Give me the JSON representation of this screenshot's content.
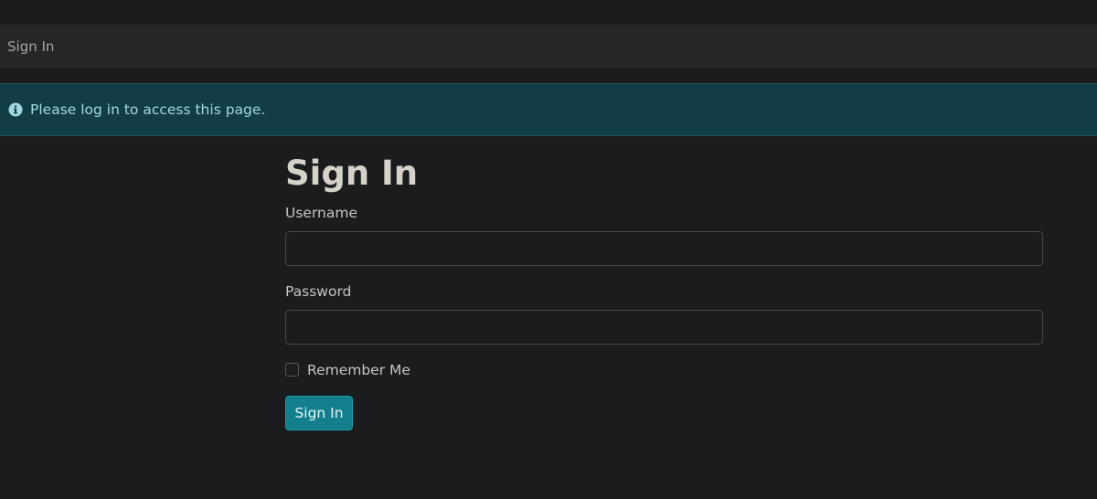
{
  "breadcrumb": {
    "text": "Sign In"
  },
  "alert": {
    "icon": "info-circle-icon",
    "message": "Please log in to access this page.",
    "color": "#9fd8e3",
    "background": "#133d44"
  },
  "form": {
    "title": "Sign In",
    "username": {
      "label": "Username",
      "value": "",
      "placeholder": ""
    },
    "password": {
      "label": "Password",
      "value": "",
      "placeholder": ""
    },
    "remember": {
      "label": "Remember Me",
      "checked": false
    },
    "submit_label": "Sign In",
    "accent": "#137f8d"
  }
}
